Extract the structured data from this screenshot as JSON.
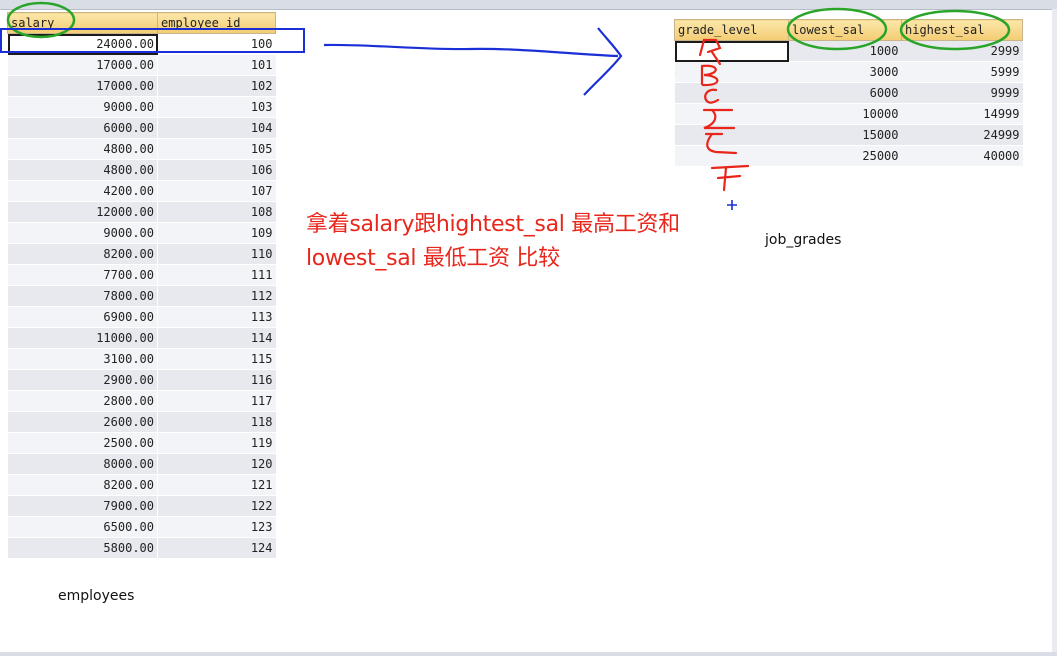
{
  "employees": {
    "caption": "employees",
    "columns": {
      "salary": "salary",
      "employee_id": "employee id"
    },
    "rows": [
      {
        "salary": "24000.00",
        "id": "100"
      },
      {
        "salary": "17000.00",
        "id": "101"
      },
      {
        "salary": "17000.00",
        "id": "102"
      },
      {
        "salary": "9000.00",
        "id": "103"
      },
      {
        "salary": "6000.00",
        "id": "104"
      },
      {
        "salary": "4800.00",
        "id": "105"
      },
      {
        "salary": "4800.00",
        "id": "106"
      },
      {
        "salary": "4200.00",
        "id": "107"
      },
      {
        "salary": "12000.00",
        "id": "108"
      },
      {
        "salary": "9000.00",
        "id": "109"
      },
      {
        "salary": "8200.00",
        "id": "110"
      },
      {
        "salary": "7700.00",
        "id": "111"
      },
      {
        "salary": "7800.00",
        "id": "112"
      },
      {
        "salary": "6900.00",
        "id": "113"
      },
      {
        "salary": "11000.00",
        "id": "114"
      },
      {
        "salary": "3100.00",
        "id": "115"
      },
      {
        "salary": "2900.00",
        "id": "116"
      },
      {
        "salary": "2800.00",
        "id": "117"
      },
      {
        "salary": "2600.00",
        "id": "118"
      },
      {
        "salary": "2500.00",
        "id": "119"
      },
      {
        "salary": "8000.00",
        "id": "120"
      },
      {
        "salary": "8200.00",
        "id": "121"
      },
      {
        "salary": "7900.00",
        "id": "122"
      },
      {
        "salary": "6500.00",
        "id": "123"
      },
      {
        "salary": "5800.00",
        "id": "124"
      }
    ]
  },
  "job_grades": {
    "caption": "job_grades",
    "columns": {
      "grade_level": "grade_level",
      "lowest_sal": "lowest_sal",
      "highest_sal": "highest_sal"
    },
    "rows": [
      {
        "grade": "A",
        "lowest": "1000",
        "highest": "2999"
      },
      {
        "grade": "B",
        "lowest": "3000",
        "highest": "5999"
      },
      {
        "grade": "C",
        "lowest": "6000",
        "highest": "9999"
      },
      {
        "grade": "D",
        "lowest": "10000",
        "highest": "14999"
      },
      {
        "grade": "E",
        "lowest": "15000",
        "highest": "24999"
      },
      {
        "grade": "F",
        "lowest": "25000",
        "highest": "40000"
      }
    ]
  },
  "annotation": {
    "line1": "拿着salary跟hightest_sal 最高工资和",
    "line2": "lowest_sal 最低工资 比较",
    "color": "#e8261b",
    "handwritten_letters": [
      "A",
      "B",
      "C",
      "D",
      "E",
      "F"
    ]
  },
  "colors": {
    "header_bg": "#f3cc73",
    "circle_green": "#2aa52a",
    "arrow_blue": "#1a2fd6",
    "box_blue": "#1a2fd6",
    "text_red": "#e8261b"
  }
}
